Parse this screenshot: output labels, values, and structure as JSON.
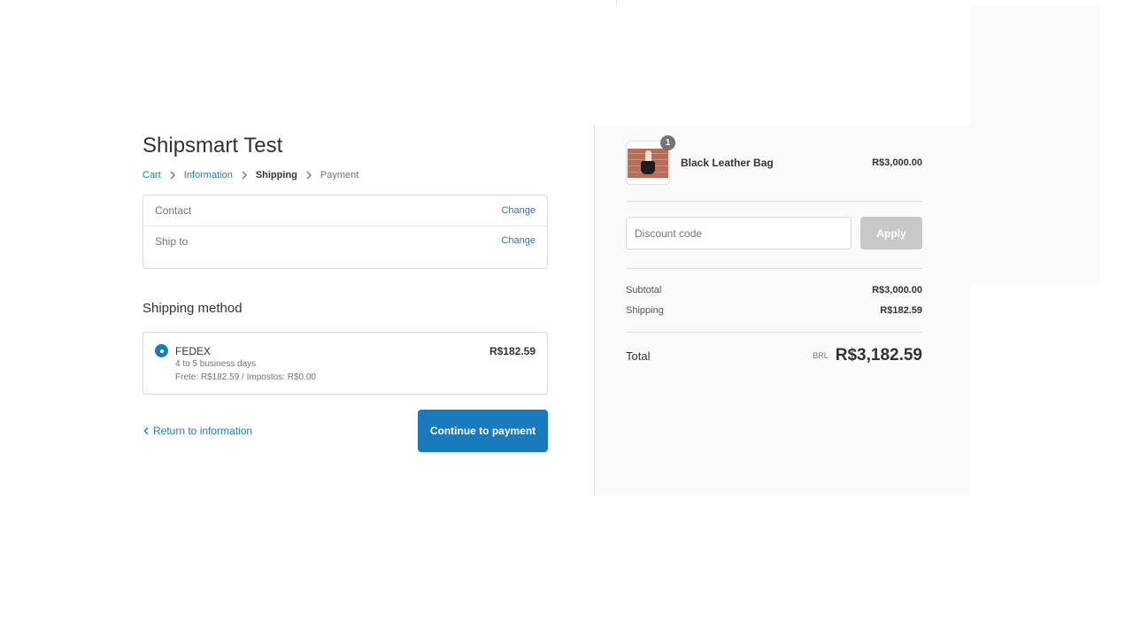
{
  "shop": {
    "title": "Shipsmart Test"
  },
  "breadcrumb": {
    "cart": "Cart",
    "information": "Information",
    "shipping": "Shipping",
    "payment": "Payment"
  },
  "review": {
    "contact_label": "Contact",
    "contact_value": "",
    "ship_to_label": "Ship to",
    "ship_to_value": "",
    "change_label": "Change"
  },
  "shipping_method": {
    "title": "Shipping method",
    "option": {
      "name": "FEDEX",
      "days": "4 to 5 business days",
      "detail": "Frete: R$182.59 / Impostos: R$0.00",
      "price": "R$182.59",
      "selected": true
    }
  },
  "actions": {
    "return_label": "Return to information",
    "continue_label": "Continue to payment"
  },
  "order_summary": {
    "product": {
      "name": "Black Leather Bag",
      "price": "R$3,000.00",
      "quantity": "1"
    },
    "discount": {
      "placeholder": "Discount code",
      "apply_label": "Apply"
    },
    "subtotal_label": "Subtotal",
    "subtotal_value": "R$3,000.00",
    "shipping_label": "Shipping",
    "shipping_value": "R$182.59",
    "total_label": "Total",
    "currency": "BRL",
    "total_value": "R$3,182.59"
  },
  "colors": {
    "accent": "#197bbd",
    "apply_disabled": "#c8c8c8",
    "sidebar_bg": "#fafafa",
    "border": "#d9d9d9"
  },
  "icons": {
    "breadcrumb_separator": "chevron-right-icon",
    "return": "chevron-left-icon",
    "radio": "radio-selected-icon"
  }
}
